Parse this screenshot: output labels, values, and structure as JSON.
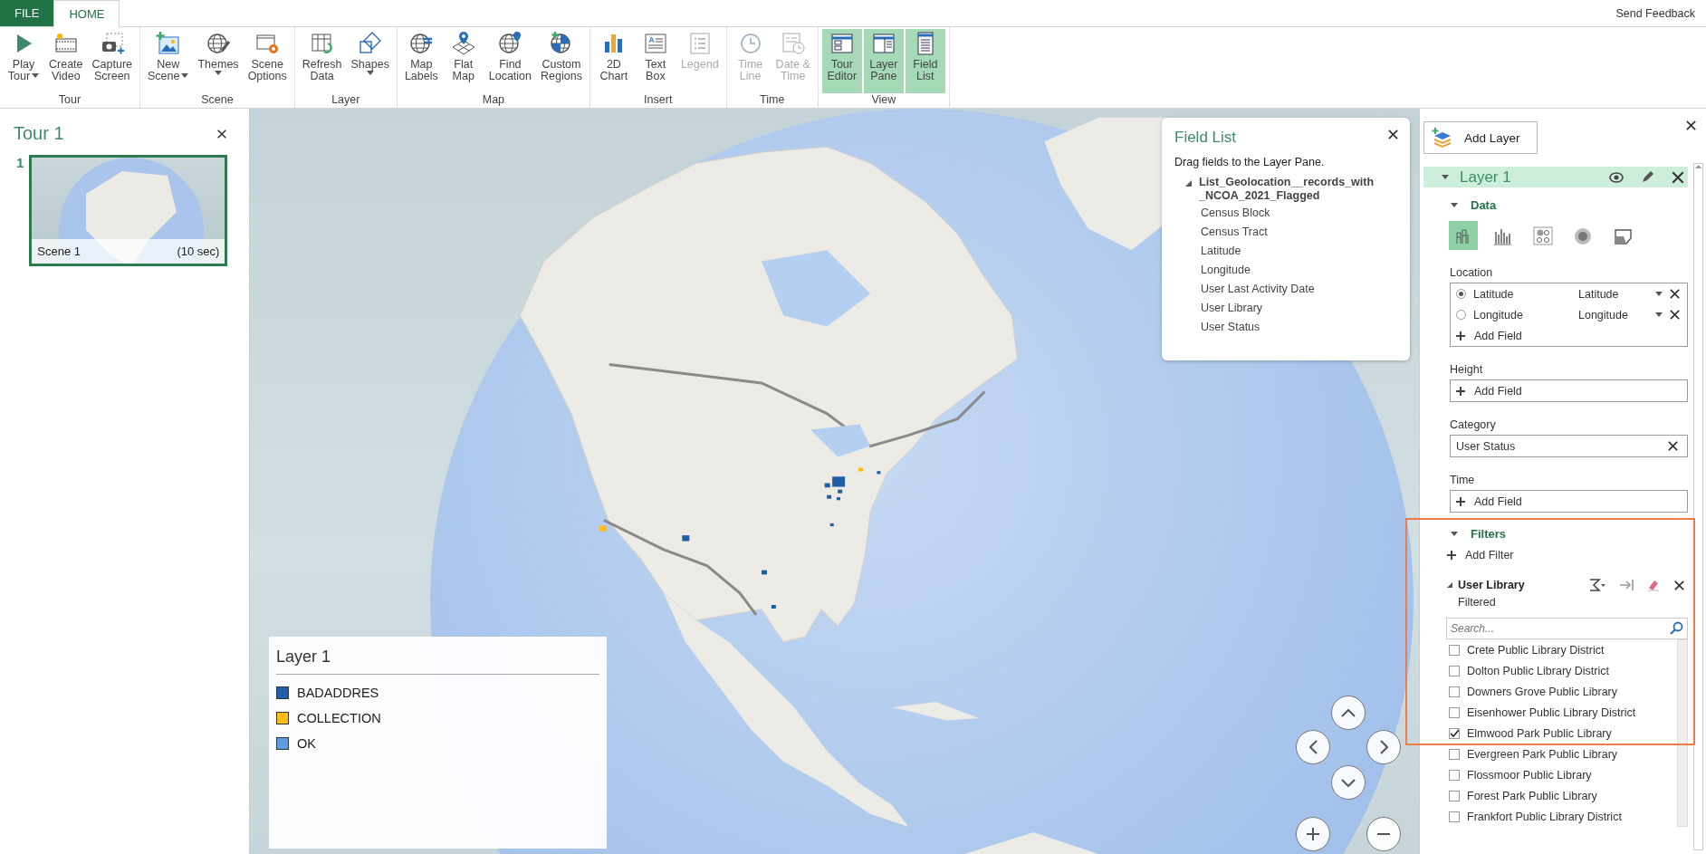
{
  "ribbon": {
    "tabs": [
      {
        "label": "FILE",
        "kind": "file",
        "selected": false
      },
      {
        "label": "HOME",
        "kind": "tab",
        "selected": true
      }
    ],
    "feedback": "Send Feedback",
    "groups": [
      {
        "label": "Tour",
        "buttons": [
          {
            "lines": [
              "Play",
              "Tour"
            ],
            "dropdown": true,
            "disabled": false,
            "selected": false
          },
          {
            "lines": [
              "Create",
              "Video"
            ],
            "dropdown": false,
            "disabled": false,
            "selected": false
          },
          {
            "lines": [
              "Capture",
              "Screen"
            ],
            "dropdown": false,
            "disabled": false,
            "selected": false
          }
        ]
      },
      {
        "label": "Scene",
        "buttons": [
          {
            "lines": [
              "New",
              "Scene"
            ],
            "dropdown": true,
            "disabled": false,
            "selected": false
          },
          {
            "lines": [
              "Themes"
            ],
            "dropdown": true,
            "disabled": false,
            "selected": false
          },
          {
            "lines": [
              "Scene",
              "Options"
            ],
            "dropdown": false,
            "disabled": false,
            "selected": false
          }
        ]
      },
      {
        "label": "Layer",
        "buttons": [
          {
            "lines": [
              "Refresh",
              "Data"
            ],
            "dropdown": false,
            "disabled": false,
            "selected": false
          },
          {
            "lines": [
              "Shapes"
            ],
            "dropdown": true,
            "disabled": false,
            "selected": false
          }
        ]
      },
      {
        "label": "Map",
        "buttons": [
          {
            "lines": [
              "Map",
              "Labels"
            ],
            "dropdown": false,
            "disabled": false,
            "selected": false
          },
          {
            "lines": [
              "Flat",
              "Map"
            ],
            "dropdown": false,
            "disabled": false,
            "selected": false
          },
          {
            "lines": [
              "Find",
              "Location"
            ],
            "dropdown": false,
            "disabled": false,
            "selected": false
          },
          {
            "lines": [
              "Custom",
              "Regions"
            ],
            "dropdown": false,
            "disabled": false,
            "selected": false
          }
        ]
      },
      {
        "label": "Insert",
        "buttons": [
          {
            "lines": [
              "2D",
              "Chart"
            ],
            "dropdown": false,
            "disabled": false,
            "selected": false
          },
          {
            "lines": [
              "Text",
              "Box"
            ],
            "dropdown": false,
            "disabled": false,
            "selected": false
          },
          {
            "lines": [
              "Legend"
            ],
            "dropdown": false,
            "disabled": true,
            "selected": false
          }
        ]
      },
      {
        "label": "Time",
        "buttons": [
          {
            "lines": [
              "Time",
              "Line"
            ],
            "dropdown": false,
            "disabled": true,
            "selected": false
          },
          {
            "lines": [
              "Date &",
              "Time"
            ],
            "dropdown": false,
            "disabled": true,
            "selected": false
          }
        ]
      },
      {
        "label": "View",
        "buttons": [
          {
            "lines": [
              "Tour",
              "Editor"
            ],
            "dropdown": false,
            "disabled": false,
            "selected": true
          },
          {
            "lines": [
              "Layer",
              "Pane"
            ],
            "dropdown": false,
            "disabled": false,
            "selected": true
          },
          {
            "lines": [
              "Field",
              "List"
            ],
            "dropdown": false,
            "disabled": false,
            "selected": true
          }
        ]
      }
    ]
  },
  "tour": {
    "title": "Tour 1",
    "scenes": [
      {
        "number": "1",
        "name": "Scene 1",
        "duration": "(10 sec)",
        "selected": true
      }
    ]
  },
  "field_list": {
    "title": "Field List",
    "hint": "Drag fields to the Layer Pane.",
    "table": {
      "name": "List_Geolocation__records_with_NCOA_2021_Flagged",
      "expanded": true,
      "fields": [
        "Census Block",
        "Census Tract",
        "Latitude",
        "Longitude",
        "User Last Activity Date",
        "User Library",
        "User Status"
      ]
    }
  },
  "legend": {
    "title": "Layer 1",
    "items": [
      {
        "label": "BADADDRES",
        "color": "#1f5fa8"
      },
      {
        "label": "COLLECTION",
        "color": "#fbbd19"
      },
      {
        "label": "OK",
        "color": "#5b9be0"
      }
    ]
  },
  "layer_pane": {
    "add_layer": "Add Layer",
    "layer": {
      "name": "Layer 1",
      "expanded": true
    },
    "data": {
      "title": "Data",
      "expanded": true,
      "viz_types": [
        {
          "selected": true
        },
        {
          "selected": false
        },
        {
          "selected": false
        },
        {
          "selected": false
        },
        {
          "selected": false
        }
      ]
    },
    "location": {
      "label": "Location",
      "fields": [
        {
          "name": "Latitude",
          "mapped": "Latitude",
          "selected": true
        },
        {
          "name": "Longitude",
          "mapped": "Longitude",
          "selected": false
        }
      ],
      "add": "Add Field"
    },
    "height": {
      "label": "Height",
      "add": "Add Field"
    },
    "category": {
      "label": "Category",
      "value": "User Status"
    },
    "time": {
      "label": "Time",
      "add": "Add Field"
    },
    "filters": {
      "title": "Filters",
      "expanded": true,
      "add": "Add Filter",
      "filter": {
        "field": "User Library",
        "expanded": true,
        "status": "Filtered",
        "search_placeholder": "Search...",
        "items": [
          {
            "label": "Crete Public Library District",
            "checked": false
          },
          {
            "label": "Dolton Public Library District",
            "checked": false
          },
          {
            "label": "Downers Grove Public Library",
            "checked": false
          },
          {
            "label": "Eisenhower Public Library District",
            "checked": false
          },
          {
            "label": "Elmwood Park Public Library",
            "checked": true
          },
          {
            "label": "Evergreen Park Public Library",
            "checked": false
          },
          {
            "label": "Flossmoor Public Library",
            "checked": false
          },
          {
            "label": "Forest Park Public Library",
            "checked": false
          },
          {
            "label": "Frankfort Public Library District",
            "checked": false
          }
        ]
      }
    }
  }
}
